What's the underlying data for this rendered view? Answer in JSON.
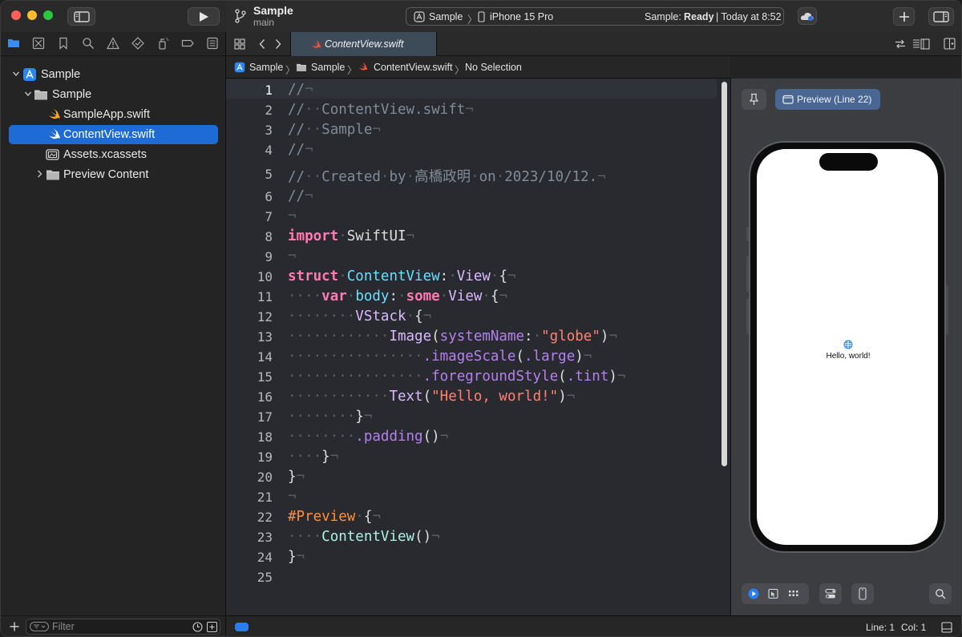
{
  "window": {
    "project_name": "Sample",
    "branch": "main"
  },
  "activity": {
    "scheme": "Sample",
    "destination": "iPhone 15 Pro",
    "status_prefix": "Sample:",
    "status_state": "Ready",
    "status_time": "| Today at 8:52"
  },
  "navigator": {
    "tree": [
      {
        "label": "Sample"
      },
      {
        "label": "Sample"
      },
      {
        "label": "SampleApp.swift"
      },
      {
        "label": "ContentView.swift"
      },
      {
        "label": "Assets.xcassets"
      },
      {
        "label": "Preview Content"
      }
    ],
    "filter_placeholder": "Filter"
  },
  "editor": {
    "tab_title": "ContentView.swift",
    "jumpbar": [
      "Sample",
      "Sample",
      "ContentView.swift",
      "No Selection"
    ]
  },
  "code": {
    "line_numbers": [
      "1",
      "2",
      "3",
      "4",
      "5",
      "6",
      "7",
      "8",
      "9",
      "10",
      "11",
      "12",
      "13",
      "14",
      "15",
      "16",
      "17",
      "18",
      "19",
      "20",
      "21",
      "22",
      "23",
      "24",
      "25"
    ],
    "lines": [
      [
        [
          "c-com",
          "//"
        ],
        [
          "c-inv",
          "¬"
        ]
      ],
      [
        [
          "c-com",
          "//"
        ],
        [
          "c-inv",
          "··"
        ],
        [
          "c-com",
          "ContentView.swift"
        ],
        [
          "c-inv",
          "¬"
        ]
      ],
      [
        [
          "c-com",
          "//"
        ],
        [
          "c-inv",
          "··"
        ],
        [
          "c-com",
          "Sample"
        ],
        [
          "c-inv",
          "¬"
        ]
      ],
      [
        [
          "c-com",
          "//"
        ],
        [
          "c-inv",
          "¬"
        ]
      ],
      [
        [
          "c-com",
          "//"
        ],
        [
          "c-inv",
          "··"
        ],
        [
          "c-com",
          "Created"
        ],
        [
          "c-inv",
          "·"
        ],
        [
          "c-com",
          "by"
        ],
        [
          "c-inv",
          "·"
        ],
        [
          "c-com",
          "高橋政明"
        ],
        [
          "c-inv",
          "·"
        ],
        [
          "c-com",
          "on"
        ],
        [
          "c-inv",
          "·"
        ],
        [
          "c-com",
          "2023/10/12."
        ],
        [
          "c-inv",
          "¬"
        ]
      ],
      [
        [
          "c-com",
          "//"
        ],
        [
          "c-inv",
          "¬"
        ]
      ],
      [
        [
          "c-inv",
          "¬"
        ]
      ],
      [
        [
          "c-kw",
          "import"
        ],
        [
          "c-inv",
          "·"
        ],
        [
          "c-plain",
          "SwiftUI"
        ],
        [
          "c-inv",
          "¬"
        ]
      ],
      [
        [
          "c-inv",
          "¬"
        ]
      ],
      [
        [
          "c-kw",
          "struct"
        ],
        [
          "c-inv",
          "·"
        ],
        [
          "c-decl",
          "ContentView"
        ],
        [
          "c-plain",
          ":"
        ],
        [
          "c-inv",
          "·"
        ],
        [
          "c-typ",
          "View"
        ],
        [
          "c-inv",
          "·"
        ],
        [
          "c-plain",
          "{"
        ],
        [
          "c-inv",
          "¬"
        ]
      ],
      [
        [
          "c-inv",
          "····"
        ],
        [
          "c-kw",
          "var"
        ],
        [
          "c-inv",
          "·"
        ],
        [
          "c-decl",
          "body"
        ],
        [
          "c-plain",
          ":"
        ],
        [
          "c-inv",
          "·"
        ],
        [
          "c-kw",
          "some"
        ],
        [
          "c-inv",
          "·"
        ],
        [
          "c-typ",
          "View"
        ],
        [
          "c-inv",
          "·"
        ],
        [
          "c-plain",
          "{"
        ],
        [
          "c-inv",
          "¬"
        ]
      ],
      [
        [
          "c-inv",
          "········"
        ],
        [
          "c-typ",
          "VStack"
        ],
        [
          "c-inv",
          "·"
        ],
        [
          "c-plain",
          "{"
        ],
        [
          "c-inv",
          "¬"
        ]
      ],
      [
        [
          "c-inv",
          "············"
        ],
        [
          "c-typ",
          "Image"
        ],
        [
          "c-plain",
          "("
        ],
        [
          "c-fn",
          "systemName"
        ],
        [
          "c-plain",
          ":"
        ],
        [
          "c-inv",
          "·"
        ],
        [
          "c-str",
          "\"globe\""
        ],
        [
          "c-plain",
          ")"
        ],
        [
          "c-inv",
          "¬"
        ]
      ],
      [
        [
          "c-inv",
          "················"
        ],
        [
          "c-fn",
          ".imageScale"
        ],
        [
          "c-plain",
          "("
        ],
        [
          "c-fn",
          ".large"
        ],
        [
          "c-plain",
          ")"
        ],
        [
          "c-inv",
          "¬"
        ]
      ],
      [
        [
          "c-inv",
          "················"
        ],
        [
          "c-fn",
          ".foregroundStyle"
        ],
        [
          "c-plain",
          "("
        ],
        [
          "c-fn",
          ".tint"
        ],
        [
          "c-plain",
          ")"
        ],
        [
          "c-inv",
          "¬"
        ]
      ],
      [
        [
          "c-inv",
          "············"
        ],
        [
          "c-typ",
          "Text"
        ],
        [
          "c-plain",
          "("
        ],
        [
          "c-str",
          "\"Hello, world!\""
        ],
        [
          "c-plain",
          ")"
        ],
        [
          "c-inv",
          "¬"
        ]
      ],
      [
        [
          "c-inv",
          "········"
        ],
        [
          "c-plain",
          "}"
        ],
        [
          "c-inv",
          "¬"
        ]
      ],
      [
        [
          "c-inv",
          "········"
        ],
        [
          "c-fn",
          ".padding"
        ],
        [
          "c-plain",
          "()"
        ],
        [
          "c-inv",
          "¬"
        ]
      ],
      [
        [
          "c-inv",
          "····"
        ],
        [
          "c-plain",
          "}"
        ],
        [
          "c-inv",
          "¬"
        ]
      ],
      [
        [
          "c-plain",
          "}"
        ],
        [
          "c-inv",
          "¬"
        ]
      ],
      [
        [
          "c-inv",
          "¬"
        ]
      ],
      [
        [
          "c-pre",
          "#Preview"
        ],
        [
          "c-inv",
          "·"
        ],
        [
          "c-plain",
          "{"
        ],
        [
          "c-inv",
          "¬"
        ]
      ],
      [
        [
          "c-inv",
          "····"
        ],
        [
          "c-cls",
          "ContentView"
        ],
        [
          "c-plain",
          "()"
        ],
        [
          "c-inv",
          "¬"
        ]
      ],
      [
        [
          "c-plain",
          "}"
        ],
        [
          "c-inv",
          "¬"
        ]
      ],
      []
    ]
  },
  "status": {
    "line": "Line: 1",
    "col": "Col: 1"
  },
  "canvas": {
    "preview_label": "Preview (Line 22)",
    "preview_text": "Hello, world!",
    "device": "iPhone 15 Pro"
  },
  "colors": {
    "accent": "#1e6bd6",
    "close": "#ff5f57",
    "minimize": "#febc2e",
    "zoom": "#28c840",
    "swift": "#f05138"
  }
}
